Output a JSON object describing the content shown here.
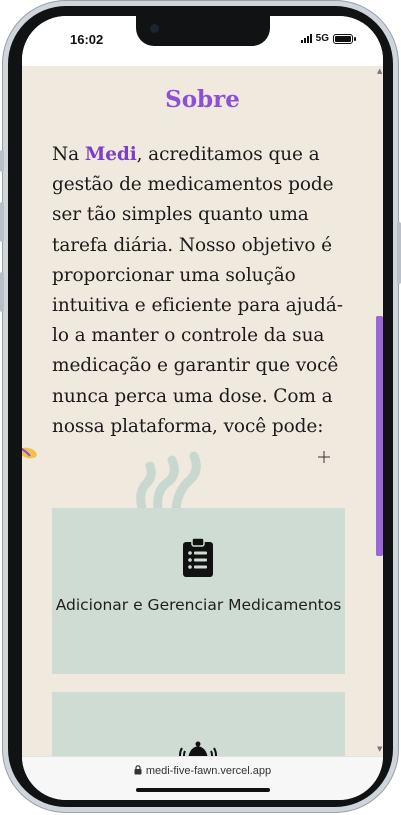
{
  "status_bar": {
    "time": "16:02",
    "network": "5G"
  },
  "about": {
    "title": "Sobre",
    "paragraph_prefix": "Na ",
    "brand": "Medi",
    "paragraph_rest": ", acreditamos que a gestão de medicamentos pode ser tão simples quanto uma tarefa diária. Nosso objetivo é proporcionar uma solução intuitiva e eficiente para ajudá-lo a manter o controle da sua medicação e garantir que você nunca perca uma dose. Com a nossa plataforma, você pode:"
  },
  "features": [
    {
      "icon": "clipboard-list-icon",
      "title": "Adicionar e Gerenciar Medicamentos"
    },
    {
      "icon": "bell-ringing-icon",
      "title": ""
    }
  ],
  "browser": {
    "url": "medi-five-fawn.vercel.app"
  },
  "colors": {
    "accent": "#8c4fd6",
    "background": "#f0e9de",
    "card": "#cfdcd3"
  }
}
